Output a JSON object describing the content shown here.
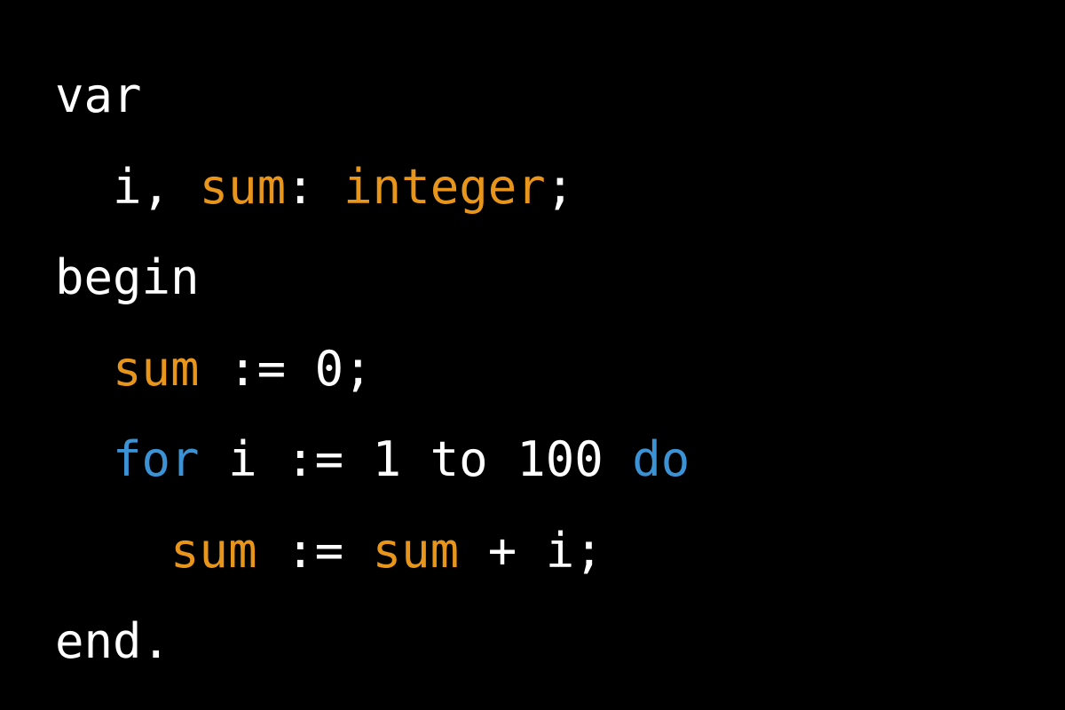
{
  "colors": {
    "background": "#000000",
    "plain": "#ffffff",
    "identifier": "#e8951c",
    "keyword": "#3b93d6"
  },
  "code": {
    "language": "Pascal",
    "lines": [
      {
        "indent": 0,
        "tokens": [
          {
            "text": "var",
            "kind": "plain"
          }
        ]
      },
      {
        "indent": 1,
        "tokens": [
          {
            "text": "i, ",
            "kind": "plain"
          },
          {
            "text": "sum",
            "kind": "ident"
          },
          {
            "text": ": ",
            "kind": "plain"
          },
          {
            "text": "integer",
            "kind": "ident"
          },
          {
            "text": ";",
            "kind": "plain"
          }
        ]
      },
      {
        "indent": 0,
        "tokens": [
          {
            "text": "begin",
            "kind": "plain"
          }
        ]
      },
      {
        "indent": 1,
        "tokens": [
          {
            "text": "sum",
            "kind": "ident"
          },
          {
            "text": " := 0;",
            "kind": "plain"
          }
        ]
      },
      {
        "indent": 1,
        "tokens": [
          {
            "text": "for",
            "kind": "keyword"
          },
          {
            "text": " i := 1 to 100 ",
            "kind": "plain"
          },
          {
            "text": "do",
            "kind": "keyword"
          }
        ]
      },
      {
        "indent": 2,
        "tokens": [
          {
            "text": "sum",
            "kind": "ident"
          },
          {
            "text": " := ",
            "kind": "plain"
          },
          {
            "text": "sum",
            "kind": "ident"
          },
          {
            "text": " + i;",
            "kind": "plain"
          }
        ]
      },
      {
        "indent": 0,
        "tokens": [
          {
            "text": "end.",
            "kind": "plain"
          }
        ]
      }
    ]
  }
}
